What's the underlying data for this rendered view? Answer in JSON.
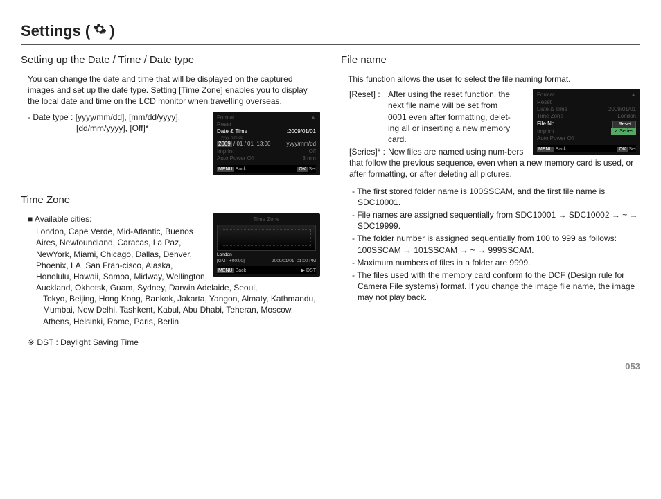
{
  "page_title_prefix": "Settings (",
  "page_title_suffix": " )",
  "page_number": "053",
  "section_datetime": {
    "heading": "Setting up the Date / Time / Date type",
    "intro": "You can change the date and time that will be displayed on the captured images and set up the date type. Setting [Time Zone] enables you to display the local date and time on the LCD monitor when travelling overseas.",
    "date_type_line1": "- Date type : [yyyy/mm/dd], [mm/dd/yyyy],",
    "date_type_line2": "[dd/mm/yyyy], [Off]*",
    "lcd": {
      "format": "Format",
      "reset": "Reset",
      "dt_label": "Date & Time",
      "dt_value": ":2009/01/01",
      "row_caption": "yyyy mm dd",
      "row_vals": "2009 / 01 / 01   13:00   yyyy/mm/dd",
      "imprint": "Imprint",
      "imprint_v": "Off",
      "apo": "Auto Power Off",
      "apo_v": "3 min",
      "back": "Back",
      "set": "Set",
      "menu_tag": "MENU",
      "ok_tag": "OK"
    }
  },
  "section_timezone": {
    "heading": "Time Zone",
    "cities_label": "■ Available cities:",
    "cities1": "London, Cape Verde, Mid-Atlantic, Buenos Aires, Newfoundland, Caracas, La Paz, NewYork, Miami, Chicago, Dallas, Denver, Phoenix, LA, San Fran-cisco, Alaska, Honolulu, Hawaii, Samoa, Midway, Wellington, Auckland, Okhotsk, Guam, Sydney, Darwin Adelaide, Seoul,",
    "cities2": "Tokyo, Beijing, Hong Kong, Bankok, Jakarta, Yangon, Almaty, Kathmandu, Mumbai, New Delhi, Tashkent, Kabul, Abu Dhabi, Teheran, Moscow, Athens, Helsinki, Rome, Paris, Berlin",
    "dst_note": "※ DST : Daylight Saving Time",
    "lcd": {
      "title": "Time Zone",
      "city": "London",
      "gmt": "[GMT +00:00]",
      "date": "2009/01/01",
      "time": "01:00 PM",
      "back": "Back",
      "dst": "DST",
      "menu_tag": "MENU"
    }
  },
  "section_filename": {
    "heading": "File name",
    "intro": "This function allows the user to select the file naming format.",
    "reset_label": "[Reset]  :",
    "reset_text": "After using the reset function, the next file name will be set from 0001 even after formatting, delet-ing all or inserting a new memory card.",
    "series_label": "[Series]* :",
    "series_text": "New files are named using num-bers that follow the previous sequence, even when a new memory card is used, or after formatting, or after deleting all pictures.",
    "bullets": [
      "- The first stored folder name is 100SSCAM, and the first file name is SDC10001.",
      "- File names are assigned sequentially from SDC10001 → SDC10002 → ~ → SDC19999.",
      "- The folder number is assigned sequentially from 100 to 999 as follows: 100SSCAM → 101SSCAM → ~ → 999SSCAM.",
      "- Maximum numbers of files in a folder are 9999.",
      "- The files used with the memory card conform to the DCF (Design rule for Camera File systems) format. If you change the image file name, the image may not play back."
    ],
    "lcd": {
      "format": "Format",
      "reset": "Reset",
      "dt": "Date & Time",
      "dt_v": "2009/01/01",
      "tz": "Time Zone",
      "tz_v": "London",
      "fileno": "File No.",
      "opt_reset": "Reset",
      "opt_series": "Series",
      "imprint": "Imprint",
      "apo": "Auto Power Off",
      "back": "Back",
      "set": "Set",
      "menu_tag": "MENU",
      "ok_tag": "OK",
      "check": "✓"
    }
  }
}
